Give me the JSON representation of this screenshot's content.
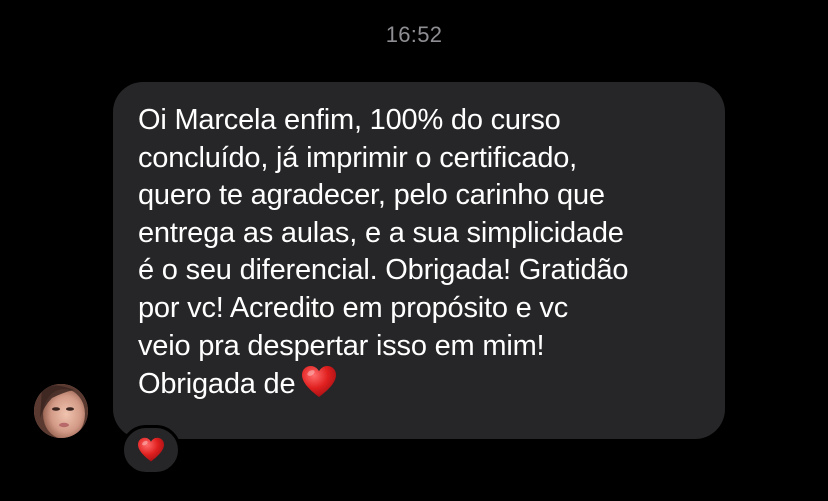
{
  "chat": {
    "timestamp": "16:52",
    "message": {
      "lines": [
        "Oi Marcela enfim, 100% do curso",
        "concluído, já imprimir o certificado,",
        "quero te agradecer, pelo carinho que",
        "entrega as aulas, e a sua simplicidade",
        "é o seu diferencial. Obrigada! Gratidão",
        "por vc! Acredito em propósito e vc",
        "veio pra despertar isso em mim!",
        "Obrigada de"
      ],
      "trailing_emoji": "red-heart-icon"
    },
    "reaction": {
      "emoji": "red-heart-icon"
    },
    "sender": {
      "avatar": "profile-photo"
    }
  },
  "colors": {
    "background": "#000000",
    "bubble": "#262628",
    "text": "#ffffff",
    "timestamp": "#8e8e93",
    "heart": "#e0201f"
  }
}
